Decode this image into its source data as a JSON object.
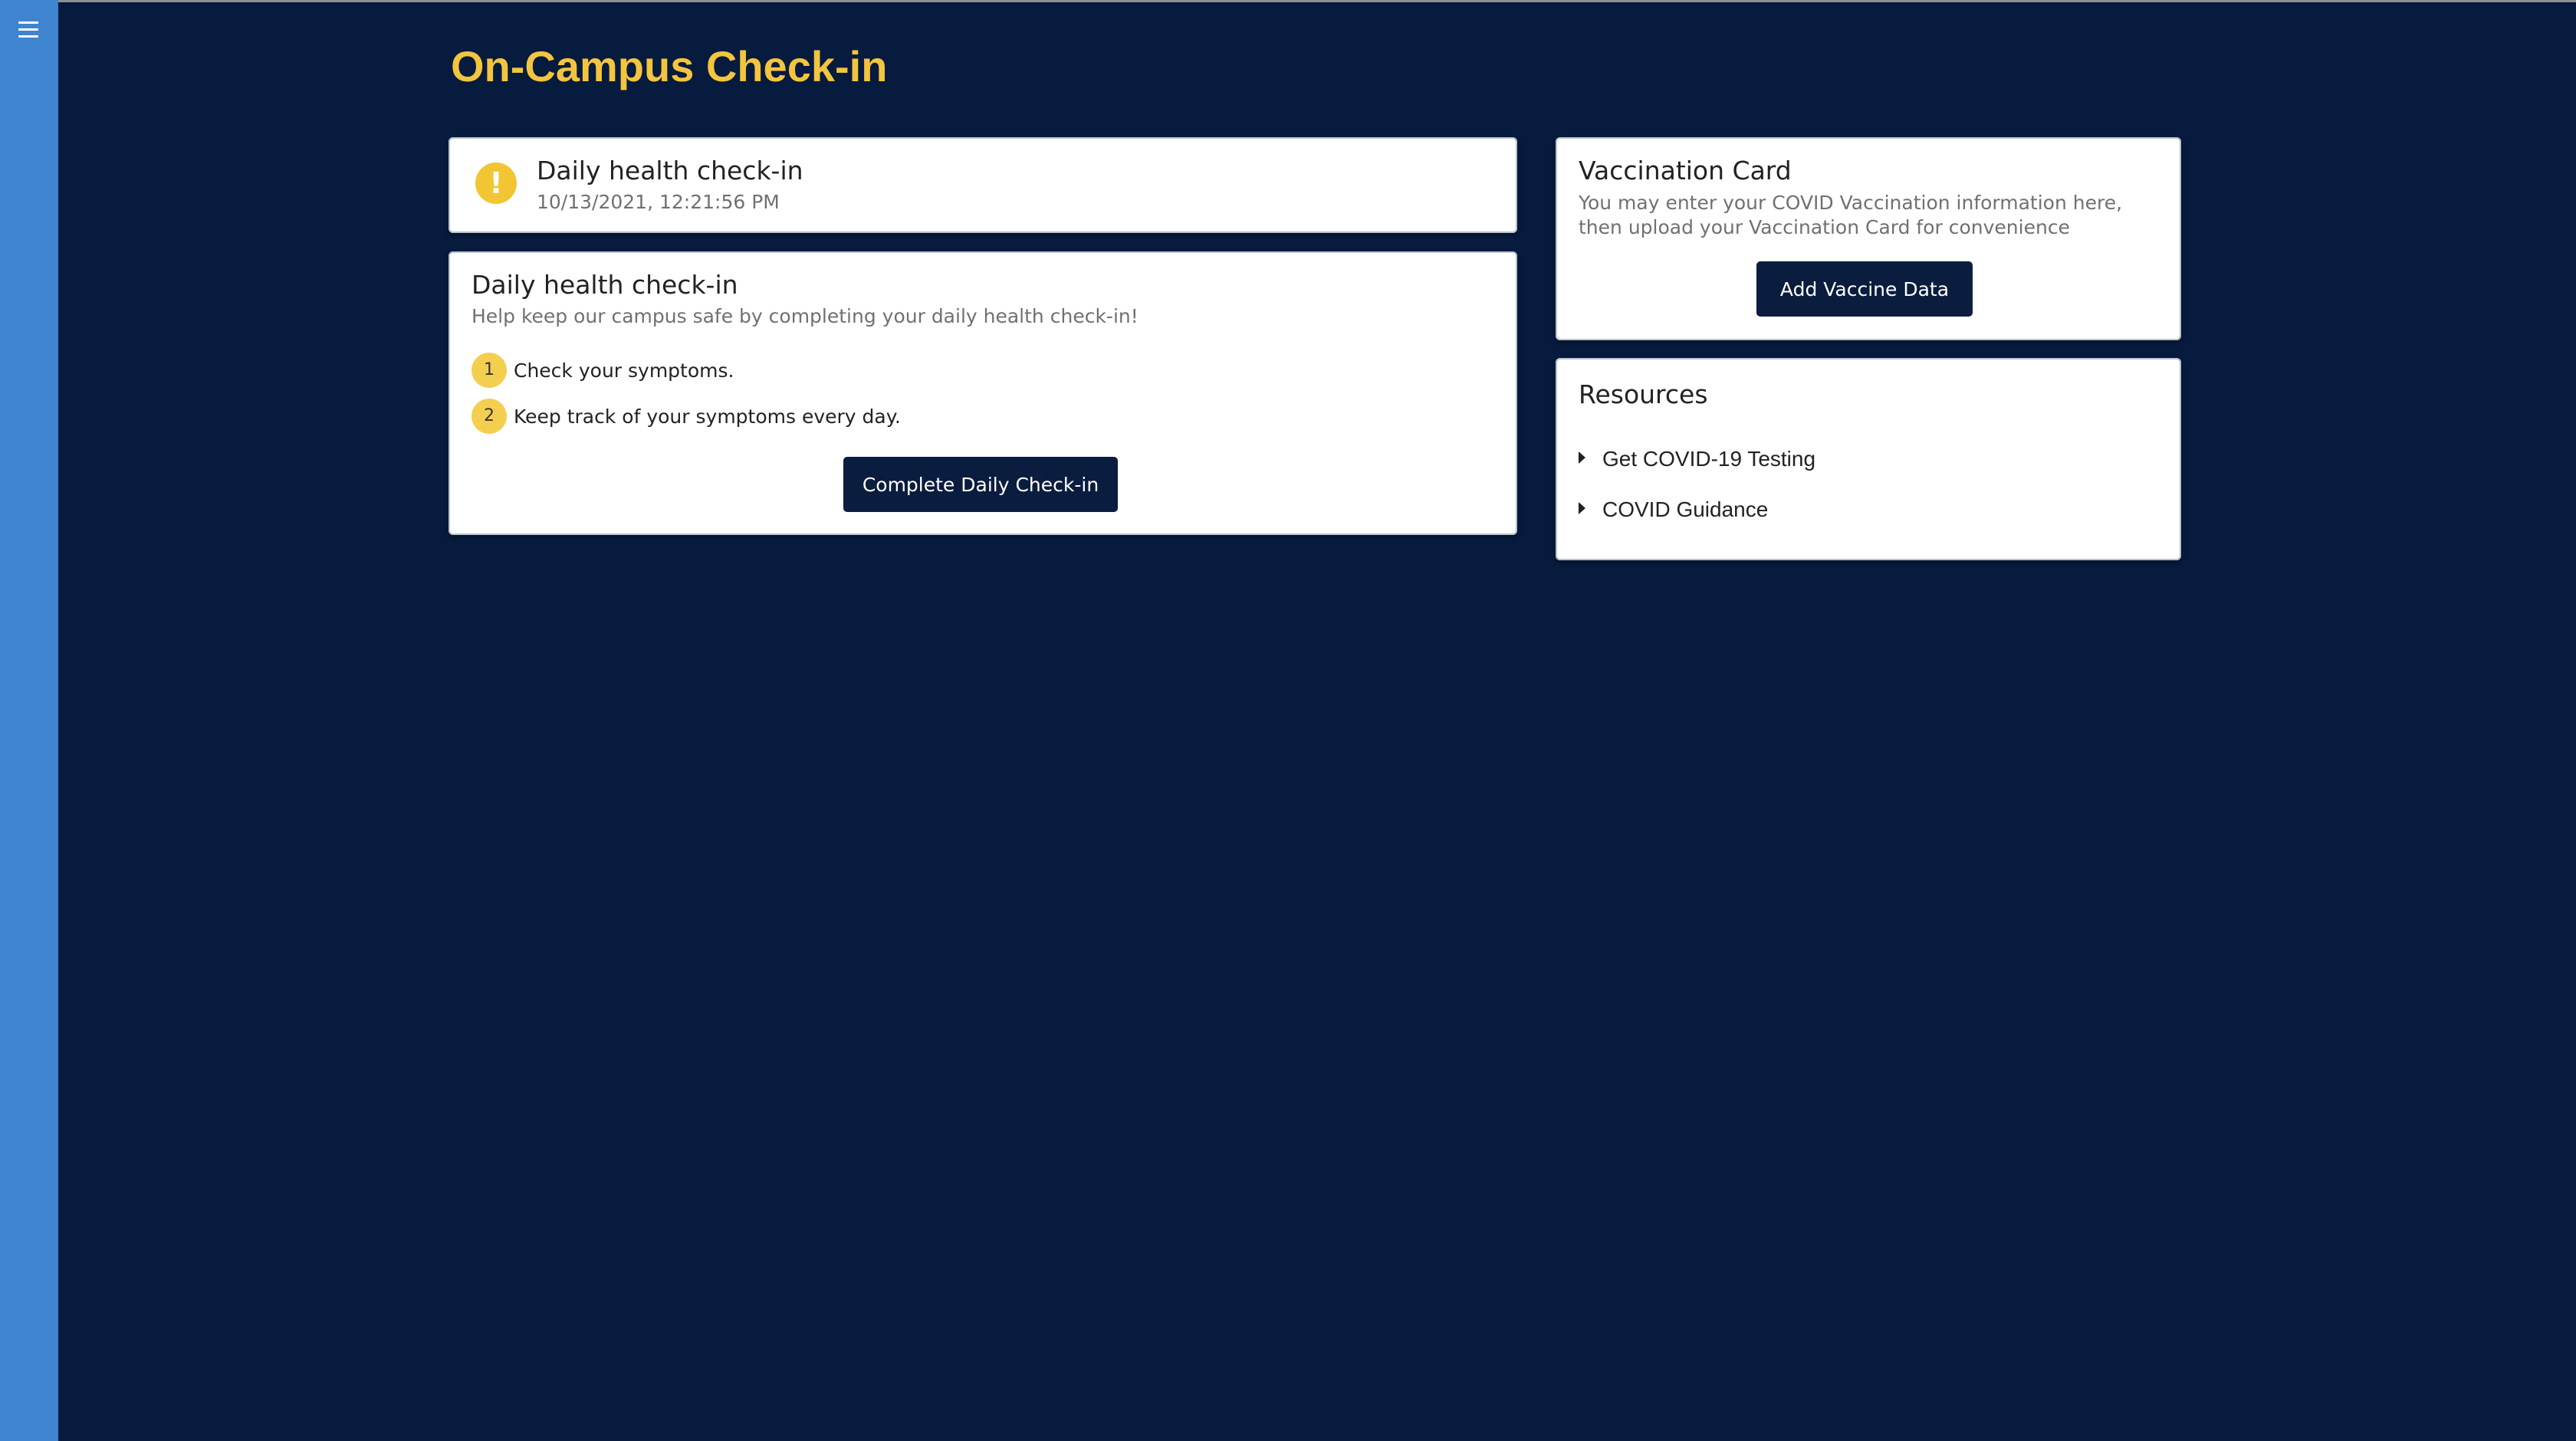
{
  "page": {
    "title": "On-Campus Check-in"
  },
  "sidebar": {
    "menu_icon": "hamburger-menu-icon"
  },
  "status_card": {
    "icon": "exclamation-icon",
    "icon_glyph": "!",
    "title": "Daily health check-in",
    "timestamp": "10/13/2021, 12:21:56 PM"
  },
  "checkin_card": {
    "title": "Daily health check-in",
    "subtitle": "Help keep our campus safe by completing your daily health check-in!",
    "steps": [
      {
        "number": "1",
        "text": "Check your symptoms."
      },
      {
        "number": "2",
        "text": "Keep track of your symptoms every day."
      }
    ],
    "button_label": "Complete Daily Check-in"
  },
  "vaccination_card": {
    "title": "Vaccination Card",
    "description": "You may enter your COVID Vaccination information here, then upload your Vaccination Card for convenience",
    "button_label": "Add Vaccine Data"
  },
  "resources_card": {
    "title": "Resources",
    "items": [
      {
        "label": "Get COVID-19 Testing",
        "icon": "caret-right-icon"
      },
      {
        "label": "COVID Guidance",
        "icon": "caret-right-icon"
      }
    ]
  },
  "colors": {
    "background": "#061b3d",
    "sidebar": "#3f84cf",
    "title": "#f3c43e",
    "warning": "#f2c533",
    "step_badge": "#f4cf4f",
    "button": "#0b1d3e"
  }
}
